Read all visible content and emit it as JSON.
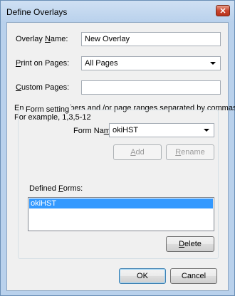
{
  "window": {
    "title": "Define Overlays",
    "close_glyph": "✕"
  },
  "overlay_name": {
    "label_pre": "Overlay ",
    "label_underlined": "N",
    "label_post": "ame:",
    "value": "New Overlay"
  },
  "print_on_pages": {
    "label_underlined": "P",
    "label_post": "rint on Pages:",
    "selected": "All Pages"
  },
  "custom_pages": {
    "label_underlined": "C",
    "label_post": "ustom Pages:",
    "value": ""
  },
  "hint": {
    "line1": "Enter page numbers and /or page ranges separated by commas,",
    "line2": "For example, 1,3,5-12"
  },
  "form_setting": {
    "group_title": "Form setting",
    "form_name_pre": "Form Na",
    "form_name_underlined": "m",
    "form_name_post": "e:",
    "form_name_selected": "okiHST",
    "add_underlined": "A",
    "add_post": "dd",
    "rename_underlined": "R",
    "rename_post": "ename",
    "defined_forms_pre": "Defined ",
    "defined_forms_underlined": "F",
    "defined_forms_post": "orms:",
    "defined_forms_items": [
      "okiHST"
    ],
    "delete_underlined": "D",
    "delete_post": "elete"
  },
  "footer": {
    "ok_label": "OK",
    "cancel_label": "Cancel"
  }
}
